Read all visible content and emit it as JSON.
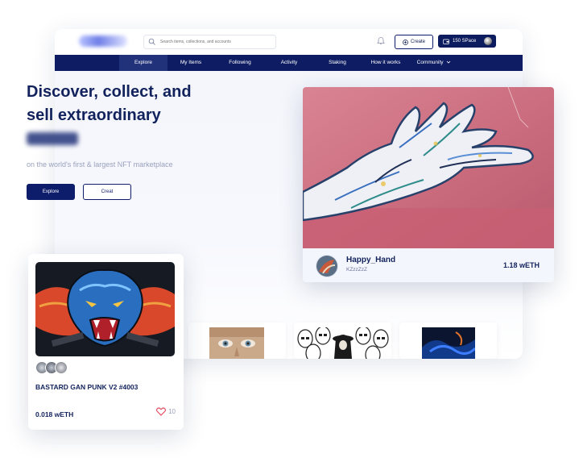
{
  "header": {
    "search_placeholder": "Search items, collections, and accounts",
    "create_label": "Create",
    "wallet_label": "150 SPace"
  },
  "nav": {
    "items": [
      {
        "label": "Explore",
        "active": true
      },
      {
        "label": "My Items"
      },
      {
        "label": "Following"
      },
      {
        "label": "Activity"
      },
      {
        "label": "Staking"
      },
      {
        "label": "How it works"
      },
      {
        "label": "Community"
      }
    ]
  },
  "hero": {
    "title_line1": "Discover, collect, and",
    "title_line2": "sell extraordinary",
    "subtitle": "on the world's first & largest NFT marketplace",
    "explore_label": "Explore",
    "creat_label": "Creat"
  },
  "featured": {
    "name": "Happy_Hand",
    "user": "KZzzZzZ",
    "price": "1.18 wETH"
  },
  "nft_card": {
    "title": "BASTARD GAN PUNK V2 #4003",
    "price": "0.018 wETH",
    "likes": "10"
  },
  "colors": {
    "navy": "#0e1d63",
    "accent": "#0d1c6b",
    "heart": "#e0455a"
  }
}
